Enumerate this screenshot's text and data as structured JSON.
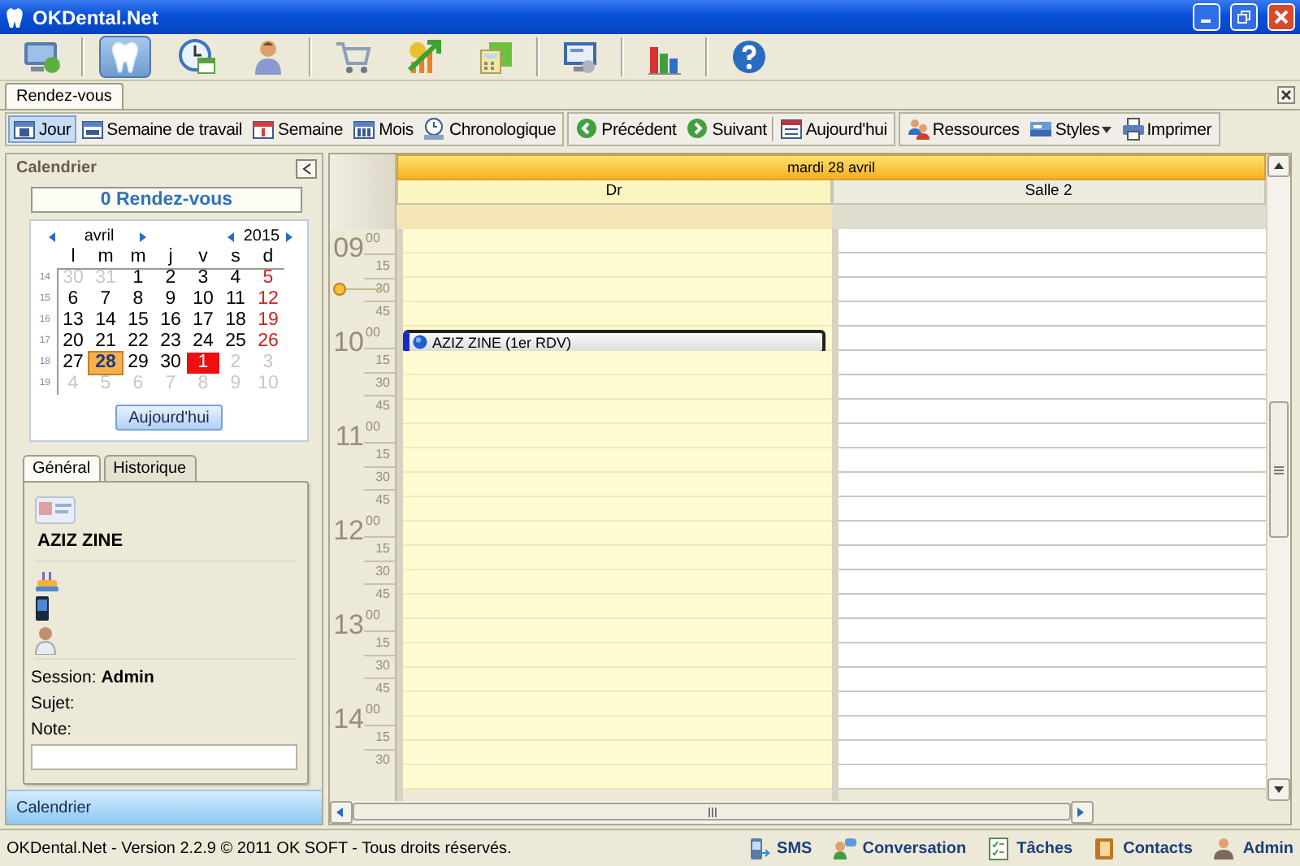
{
  "window": {
    "title": "OKDental.Net"
  },
  "main_toolbar": [
    [
      {
        "selected": false
      }
    ],
    [
      {
        "selected": true
      },
      {
        "selected": false
      },
      {
        "selected": false
      }
    ],
    [
      {
        "selected": false
      },
      {
        "selected": false
      },
      {
        "selected": false
      }
    ],
    [
      {
        "selected": false
      }
    ],
    [
      {
        "selected": false
      }
    ],
    [
      {
        "selected": false
      }
    ]
  ],
  "document_tabs": [
    {
      "label": "Rendez-vous",
      "selected": true
    }
  ],
  "view_toolbar": [
    [
      {
        "label": "Jour",
        "kind": "day",
        "selected": true
      },
      {
        "label": "Semaine de travail",
        "kind": "workweek",
        "selected": false
      },
      {
        "label": "Semaine",
        "kind": "week",
        "selected": false
      },
      {
        "label": "Mois",
        "kind": "month",
        "selected": false
      },
      {
        "label": "Chronologique",
        "kind": "timeline",
        "selected": false
      }
    ],
    [
      {
        "label": "Précédent",
        "kind": "previous",
        "selected": false
      },
      {
        "label": "Suivant",
        "kind": "next",
        "selected": false
      },
      {
        "label": "Aujourd'hui",
        "kind": "today",
        "selected": false
      }
    ],
    [
      {
        "label": "Ressources",
        "kind": "resources",
        "selected": false
      },
      {
        "label": "Styles",
        "kind": "styles",
        "selected": false
      },
      {
        "label": "Imprimer",
        "kind": "print",
        "selected": false
      }
    ]
  ],
  "calendar_panel": {
    "title": "Calendrier",
    "appointment_count": "0 Rendez-vous",
    "month": "avril",
    "year": "2015",
    "weekdays": [
      "l",
      "m",
      "m",
      "j",
      "v",
      "s",
      "d"
    ],
    "weeks": [
      {
        "number": "14",
        "days": [
          {
            "day": "30",
            "kind": "other",
            "selected": false
          },
          {
            "day": "31",
            "kind": "other",
            "selected": false
          },
          {
            "day": "1",
            "kind": "weekday",
            "selected": false
          },
          {
            "day": "2",
            "kind": "weekday",
            "selected": false
          },
          {
            "day": "3",
            "kind": "weekday",
            "selected": false
          },
          {
            "day": "4",
            "kind": "weekday",
            "selected": false
          },
          {
            "day": "5",
            "kind": "sunday",
            "selected": false
          }
        ]
      },
      {
        "number": "15",
        "days": [
          {
            "day": "6",
            "kind": "weekday",
            "selected": false
          },
          {
            "day": "7",
            "kind": "weekday",
            "selected": false
          },
          {
            "day": "8",
            "kind": "weekday",
            "selected": false
          },
          {
            "day": "9",
            "kind": "weekday",
            "selected": false
          },
          {
            "day": "10",
            "kind": "weekday",
            "selected": false
          },
          {
            "day": "11",
            "kind": "weekday",
            "selected": false
          },
          {
            "day": "12",
            "kind": "sunday",
            "selected": false
          }
        ]
      },
      {
        "number": "16",
        "days": [
          {
            "day": "13",
            "kind": "weekday",
            "selected": false
          },
          {
            "day": "14",
            "kind": "weekday",
            "selected": false
          },
          {
            "day": "15",
            "kind": "weekday",
            "selected": false
          },
          {
            "day": "16",
            "kind": "weekday",
            "selected": false
          },
          {
            "day": "17",
            "kind": "weekday",
            "selected": false
          },
          {
            "day": "18",
            "kind": "weekday",
            "selected": false
          },
          {
            "day": "19",
            "kind": "sunday",
            "selected": false
          }
        ]
      },
      {
        "number": "17",
        "days": [
          {
            "day": "20",
            "kind": "weekday",
            "selected": false
          },
          {
            "day": "21",
            "kind": "weekday",
            "selected": false
          },
          {
            "day": "22",
            "kind": "weekday",
            "selected": false
          },
          {
            "day": "23",
            "kind": "weekday",
            "selected": false
          },
          {
            "day": "24",
            "kind": "weekday",
            "selected": false
          },
          {
            "day": "25",
            "kind": "weekday",
            "selected": false
          },
          {
            "day": "26",
            "kind": "sunday",
            "selected": false
          }
        ]
      },
      {
        "number": "18",
        "days": [
          {
            "day": "27",
            "kind": "weekday",
            "selected": false
          },
          {
            "day": "28",
            "kind": "weekday",
            "selected": true
          },
          {
            "day": "29",
            "kind": "weekday",
            "selected": false
          },
          {
            "day": "30",
            "kind": "weekday",
            "selected": false
          },
          {
            "day": "1",
            "kind": "holiday",
            "selected": false
          },
          {
            "day": "2",
            "kind": "other",
            "selected": false
          },
          {
            "day": "3",
            "kind": "other",
            "selected": false
          }
        ]
      },
      {
        "number": "19",
        "days": [
          {
            "day": "4",
            "kind": "other",
            "selected": false
          },
          {
            "day": "5",
            "kind": "other",
            "selected": false
          },
          {
            "day": "6",
            "kind": "other",
            "selected": false
          },
          {
            "day": "7",
            "kind": "other",
            "selected": false
          },
          {
            "day": "8",
            "kind": "other",
            "selected": false
          },
          {
            "day": "9",
            "kind": "other",
            "selected": false
          },
          {
            "day": "10",
            "kind": "other",
            "selected": false
          }
        ]
      }
    ],
    "today_button": "Aujourd'hui"
  },
  "detail_tabs": [
    {
      "label": "Général",
      "selected": true
    },
    {
      "label": "Historique",
      "selected": false
    }
  ],
  "patient": {
    "name": "AZIZ ZINE",
    "session": "Session: **Admin**",
    "subject_label": "Sujet:",
    "note_label": "Note:"
  },
  "navigation_bar": {
    "label": "Calendrier"
  },
  "scheduler": {
    "date": "mardi 28 avril",
    "resources": [
      {
        "name": "Dr",
        "selected": true
      },
      {
        "name": "Salle 2",
        "selected": false
      }
    ],
    "hours": [
      {
        "hour": "09",
        "minutes": "00",
        "quarters": [
          {
            "label": "15",
            "current": false
          },
          {
            "label": "30",
            "current": true
          },
          {
            "label": "45",
            "current": false
          }
        ]
      },
      {
        "hour": "10",
        "minutes": "00",
        "appointments": [
          {
            "text": "AZIZ ZINE (1er RDV)"
          }
        ],
        "quarters": [
          {
            "label": "15",
            "current": false
          },
          {
            "label": "30",
            "current": false
          },
          {
            "label": "45",
            "current": false
          }
        ]
      },
      {
        "hour": "11",
        "minutes": "00",
        "quarters": [
          {
            "label": "15",
            "current": false
          },
          {
            "label": "30",
            "current": false
          },
          {
            "label": "45",
            "current": false
          }
        ]
      },
      {
        "hour": "12",
        "minutes": "00",
        "quarters": [
          {
            "label": "15",
            "current": false
          },
          {
            "label": "30",
            "current": false
          },
          {
            "label": "45",
            "current": false
          }
        ]
      },
      {
        "hour": "13",
        "minutes": "00",
        "quarters": [
          {
            "label": "15",
            "current": false
          },
          {
            "label": "30",
            "current": false
          },
          {
            "label": "45",
            "current": false
          }
        ]
      },
      {
        "hour": "14",
        "minutes": "00",
        "quarters": [
          {
            "label": "15",
            "current": false
          },
          {
            "label": "30",
            "current": false
          }
        ]
      }
    ]
  },
  "status_bar": {
    "text": "OKDental.Net - Version 2.2.9 © 2011 OK SOFT - Tous droits réservés.",
    "items": [
      {
        "label": "SMS",
        "kind": "sms"
      },
      {
        "label": "Conversation",
        "kind": "chat"
      },
      {
        "label": "Tâches",
        "kind": "tasks"
      },
      {
        "label": "Contacts",
        "kind": "contacts"
      },
      {
        "label": "Admin",
        "kind": "user"
      }
    ]
  }
}
